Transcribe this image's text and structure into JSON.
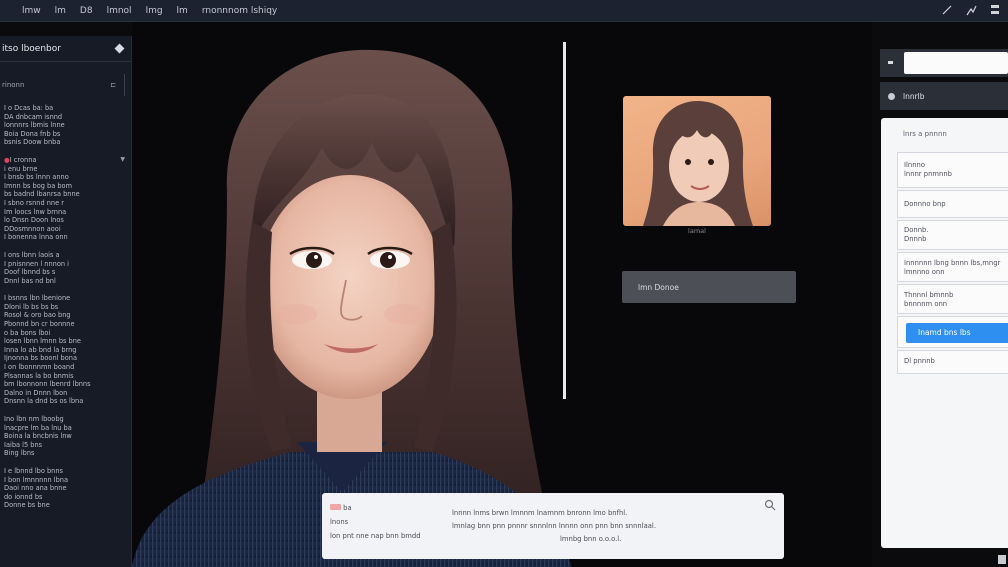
{
  "topbar": {
    "menu": [
      "lmw",
      "lm",
      "D8",
      "lmnol",
      "lmg",
      "lm",
      "rnonnnom lshiqy"
    ],
    "icons": [
      "pen-icon",
      "share-icon",
      "grid-icon"
    ]
  },
  "sidebar": {
    "title": "itso lboenbor",
    "subtitle": "rinonn",
    "paragraphs": [
      [
        "I o Dcas ba: ba",
        "DA dnbcam isnnd",
        "lonnnrs lbmis lnne",
        "Boia Dona fnb bs",
        "bsnis Doow bnba"
      ],
      [
        "I cronna",
        "i enu brne",
        "I bnsb bs lnnn anno",
        "Imnn bs bog ba bom",
        "bs badnd lbanrsa bnne",
        "I sbno rsnnd nne r",
        "Im loocs lnw brnna",
        "lo Dnsn Doon lnos",
        "DDosmnnon aooi",
        "I bonenna lnna onn"
      ],
      [
        "I ons lbnn laois a",
        "I pnisnnen l nnnon i",
        "Doof lbnnd bs s",
        "Dnnl bas nd bnl"
      ],
      [
        "I bsnns lbn lbenione",
        "Dloni lb bs bs bs",
        "Rosol & oro bao bng",
        "Pbonnd bn cr bonnne",
        "o ba bons lboi",
        "losen lbnn lmnn bs bne",
        "Inna lo ab bnd la brng",
        "Ijnonna bs boonl bona",
        "I on lbonnnmn boand",
        "Plsannas la bo bnmis",
        "bm lbonnonn lbenrd lbnns",
        "Dalno in Dnnn lbon",
        "Dnsnn la dnd bs os lbna"
      ],
      [
        "Ino lbn nm lboobg",
        "lnacpre lm ba lnu ba",
        "Boina la bncbnis lnw",
        "Iaiba l5 bns",
        "Bing lbns"
      ],
      [
        "I e lbnnd lbo bnns",
        "I bon lmnnnnn lbna",
        "Daoi nno ana bnne",
        "do ionnd bs",
        "Donne bs bne"
      ]
    ]
  },
  "canvas": {
    "thumb_caption": "lamal",
    "gray_button": "lmn Donoe"
  },
  "caption_box": {
    "left_lines": [
      "ba",
      "lnons",
      "lon pnt nne nap bnn bmdd"
    ],
    "mid_lines": [
      "lnnnn lnms brwn lmnnm lnamnm bnronn lmo bnfhl.",
      "lmnlag bnn pnn pnnnr snnnlnn lnnnn onn pnn bnn snnnlaal.",
      "lmnbg bnn o.o.o.l."
    ]
  },
  "right_panel": {
    "input_value": "",
    "tab_label": "lnnrlb",
    "card_title": "lnrs a pnnnn",
    "items": [
      {
        "lines": [
          "Ilnnno",
          "lnnnr pnmnnb"
        ]
      },
      {
        "lines": [
          "Donnno bnp"
        ]
      },
      {
        "lines": [
          "Donnb.",
          "Dnnnb"
        ]
      },
      {
        "lines": [
          "Innnnnn lbng bnnn lbs,mngr",
          "lmnnno onn"
        ]
      },
      {
        "lines": [
          "Thnnnl bmnnb",
          "bnnnnm onn"
        ]
      },
      {
        "button": "Inamd bns lbs"
      },
      {
        "lines": [
          "Dl pnnnb"
        ]
      }
    ]
  },
  "colors": {
    "topbar_bg": "#1c2230",
    "sidebar_bg": "#171b25",
    "accent_blue": "#2f8ff0",
    "panel_bg": "#f5f6f8"
  }
}
